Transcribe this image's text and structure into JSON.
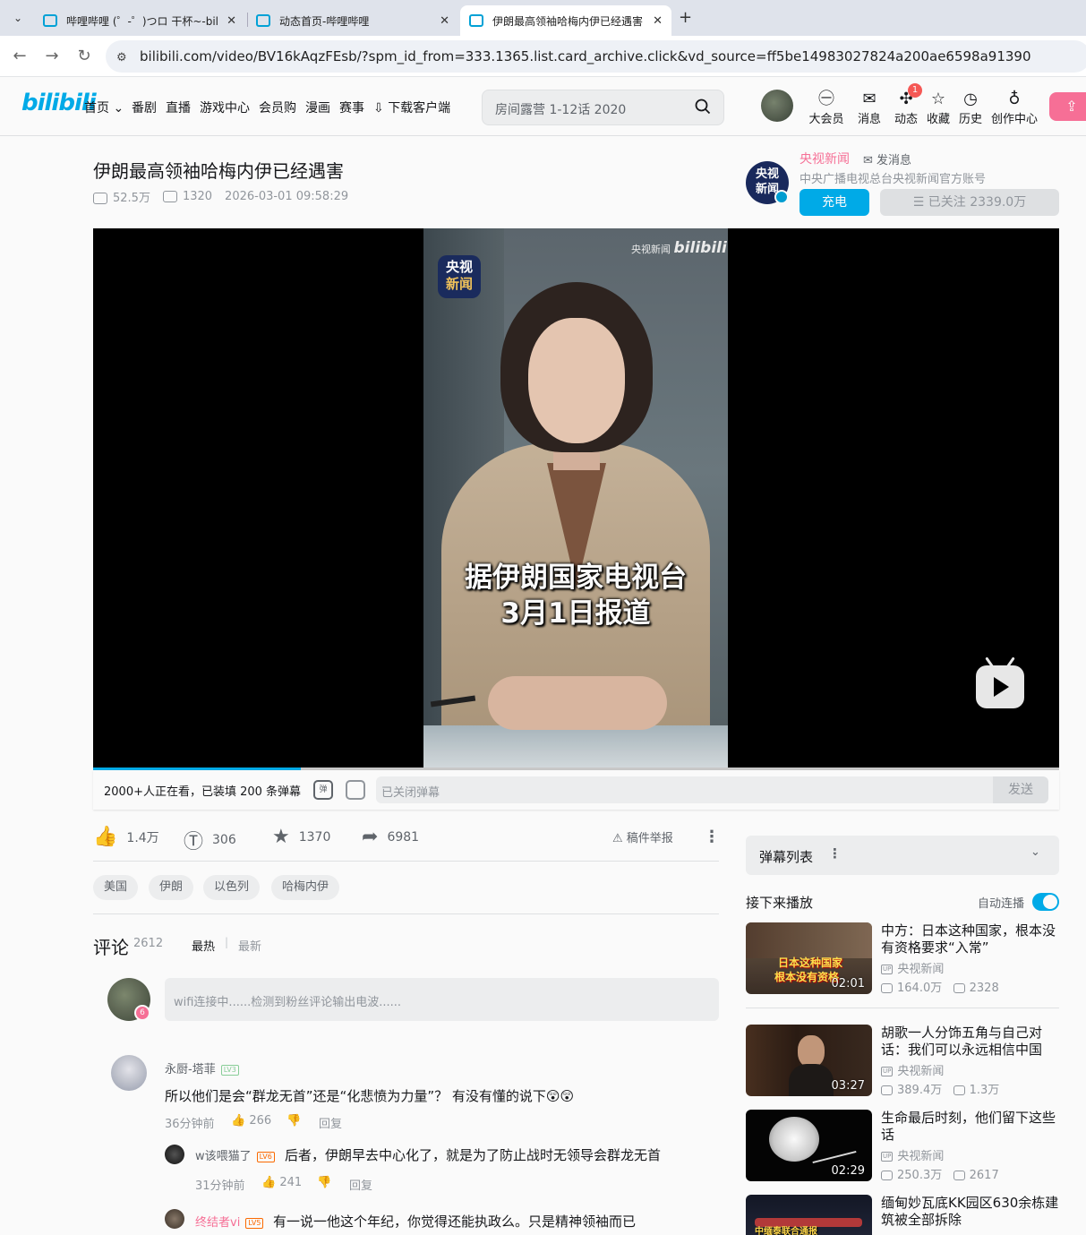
{
  "browser": {
    "tabs": [
      {
        "label": "哔哩哔哩 (゜-゜)つロ 干杯~-bili"
      },
      {
        "label": "动态首页-哔哩哔哩"
      },
      {
        "label": "伊朗最高领袖哈梅内伊已经遇害"
      }
    ],
    "url": "bilibili.com/video/BV16kAqzFEsb/?spm_id_from=333.1365.list.card_archive.click&vd_source=ff5be14983027824a200ae6598a91390"
  },
  "header": {
    "logo": "bilibili",
    "nav": [
      "首页",
      "番剧",
      "直播",
      "游戏中心",
      "会员购",
      "漫画",
      "赛事",
      "下载客户端"
    ],
    "search_placeholder": "房间露营 1-12话 2020",
    "icons": [
      {
        "label": "大会员",
        "icon": "vip-icon"
      },
      {
        "label": "消息",
        "icon": "message-icon"
      },
      {
        "label": "动态",
        "icon": "dynamic-icon"
      },
      {
        "label": "收藏",
        "icon": "star-icon"
      },
      {
        "label": "历史",
        "icon": "clock-icon"
      },
      {
        "label": "创作中心",
        "icon": "bulb-icon"
      }
    ],
    "dynamic_badge": "1",
    "accent": "#00aeec",
    "pink": "#fb7299"
  },
  "video": {
    "title": "伊朗最高领袖哈梅内伊已经遇害",
    "views": "52.5万",
    "danmaku_count": "1320",
    "datetime": "2026-03-01 09:58:29",
    "subtitle_line1": "据伊朗国家电视台",
    "subtitle_line2": "3月1日报道",
    "logo_line1": "央视",
    "logo_line2": "新闻",
    "watermark": "央视新闻",
    "watermark_brand": "bilibili",
    "progress_fraction": 0.215
  },
  "uploader": {
    "name": "央视新闻",
    "send_msg": "发消息",
    "desc": "中央广播电视总台央视新闻官方账号",
    "avatar_text1": "央视",
    "avatar_text2": "新闻",
    "charge": "充电",
    "follow": "已关注 2339.0万"
  },
  "danmaku_bar": {
    "viewers": "2000+人正在看，已装填 200 条弹幕",
    "toggle_label": "弹",
    "input_placeholder": "已关闭弹幕",
    "send": "发送"
  },
  "actions": {
    "like": "1.4万",
    "coin": "306",
    "fav": "1370",
    "share": "6981",
    "report": "稿件举报"
  },
  "tags": [
    "美国",
    "伊朗",
    "以色列",
    "哈梅内伊"
  ],
  "comments": {
    "title": "评论",
    "count": "2612",
    "sort_hot": "最热",
    "sort_sep": "|",
    "sort_new": "最新",
    "my_level": "6",
    "input_placeholder": "wifi连接中......检测到粉丝评论输出电波......",
    "items": [
      {
        "user": "永厨-塔菲",
        "level": "LV3",
        "text": "所以他们是会“群龙无首”还是“化悲愤为力量”？ 有没有懂的说下😲😲",
        "time": "36分钟前",
        "likes": "266",
        "reply": "回复"
      }
    ],
    "replies": [
      {
        "user": "w该喂猫了",
        "level": "LV6",
        "text": "后者，伊朗早去中心化了，就是为了防止战时无领导会群龙无首",
        "time": "31分钟前",
        "likes": "241",
        "reply": "回复"
      },
      {
        "user": "终结者vi",
        "level": "LV5",
        "text": "有一说一他这个年纪，你觉得还能执政么。只是精神领袖而已"
      }
    ]
  },
  "sidebar": {
    "danmaku_list": "弹幕列表",
    "next_label": "接下来播放",
    "autoplay": "自动连播",
    "up_tag": "UP",
    "recommend": [
      {
        "title": "中方：日本这种国家，根本没有资格要求“入常”",
        "up": "央视新闻",
        "views": "164.0万",
        "danmaku": "2328",
        "duration": "02:01",
        "thumb_caption1": "日本这种国家",
        "thumb_caption2": "根本没有资格"
      },
      {
        "title": "胡歌一人分饰五角与自己对话：我们可以永远相信中国",
        "up": "央视新闻",
        "views": "389.4万",
        "danmaku": "1.3万",
        "duration": "03:27"
      },
      {
        "title": "生命最后时刻，他们留下这些话",
        "up": "央视新闻",
        "views": "250.3万",
        "danmaku": "2617",
        "duration": "02:29"
      },
      {
        "title": "缅甸妙瓦底KK园区630余栋建筑被全部拆除",
        "thumb_caption1": "中缅泰联合通报"
      }
    ]
  }
}
